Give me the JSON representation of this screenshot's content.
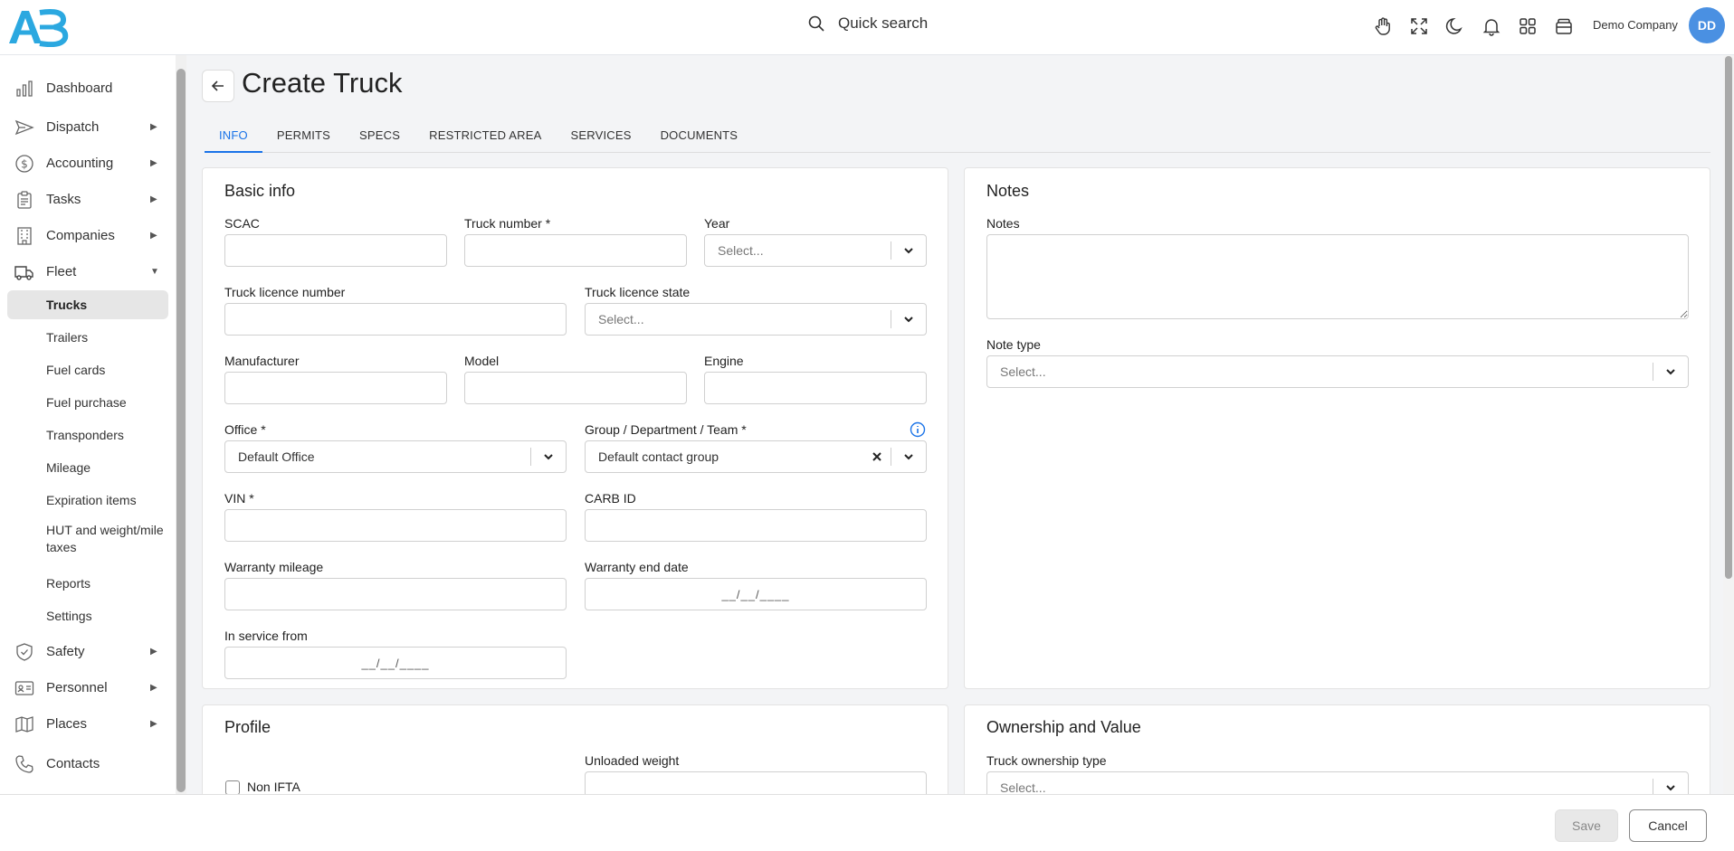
{
  "header": {
    "search_label": "Quick search",
    "company": "Demo Company",
    "avatar_initials": "DD",
    "logo_color": "#2ba8e0"
  },
  "sidebar": {
    "items": [
      {
        "label": "Dashboard",
        "icon": "bar-chart-icon"
      },
      {
        "label": "Dispatch",
        "icon": "send-icon"
      },
      {
        "label": "Accounting",
        "icon": "dollar-icon"
      },
      {
        "label": "Tasks",
        "icon": "clipboard-icon"
      },
      {
        "label": "Companies",
        "icon": "building-icon"
      },
      {
        "label": "Fleet",
        "icon": "truck-icon"
      },
      {
        "label": "Safety",
        "icon": "shield-icon"
      },
      {
        "label": "Personnel",
        "icon": "id-card-icon"
      },
      {
        "label": "Places",
        "icon": "map-icon"
      },
      {
        "label": "Contacts",
        "icon": "phone-icon"
      }
    ],
    "fleet_sub": [
      "Trucks",
      "Trailers",
      "Fuel cards",
      "Fuel purchase",
      "Transponders",
      "Mileage",
      "Expiration items",
      "HUT and weight/mile taxes",
      "Reports",
      "Settings"
    ]
  },
  "page": {
    "title": "Create Truck",
    "tabs": [
      "INFO",
      "PERMITS",
      "SPECS",
      "RESTRICTED AREA",
      "SERVICES",
      "DOCUMENTS"
    ]
  },
  "basic_info": {
    "title": "Basic info",
    "scac": "SCAC",
    "truck_number": "Truck number *",
    "year": "Year",
    "year_ph": "Select...",
    "licence_number": "Truck licence number",
    "licence_state": "Truck licence state",
    "licence_state_ph": "Select...",
    "manufacturer": "Manufacturer",
    "model": "Model",
    "engine": "Engine",
    "office": "Office *",
    "office_value": "Default Office",
    "group": "Group / Department / Team *",
    "group_value": "Default contact group",
    "vin": "VIN *",
    "carb_id": "CARB ID",
    "warranty_mileage": "Warranty mileage",
    "warranty_end": "Warranty end date",
    "date_mask": "__/__/____",
    "in_service": "In service from"
  },
  "notes": {
    "title": "Notes",
    "notes_label": "Notes",
    "note_type": "Note type",
    "note_type_ph": "Select..."
  },
  "profile": {
    "title": "Profile",
    "non_ifta": "Non IFTA",
    "unloaded_weight": "Unloaded weight"
  },
  "ownership": {
    "title": "Ownership and Value",
    "ownership_type": "Truck ownership type",
    "ownership_ph": "Select..."
  },
  "footer": {
    "save": "Save",
    "cancel": "Cancel"
  },
  "colors": {
    "accent": "#1a73e8",
    "avatar_bg": "#4a90e2"
  }
}
